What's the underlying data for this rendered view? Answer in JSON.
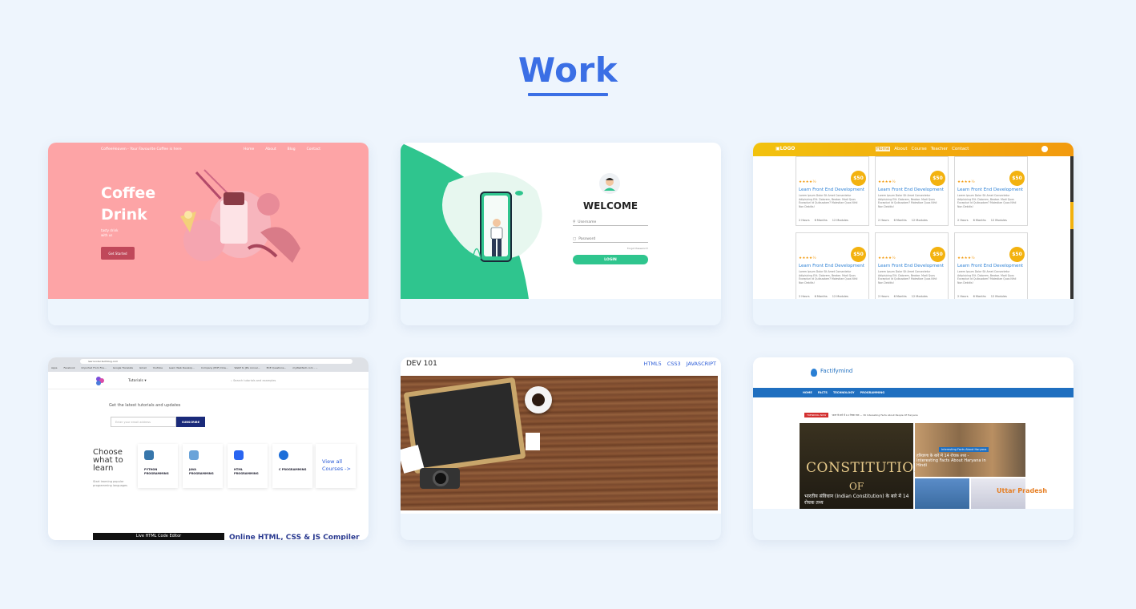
{
  "section": {
    "title": "Work"
  },
  "colors": {
    "accent": "#3b6fe5",
    "background": "#eef5fd"
  },
  "cards": [
    {
      "id": "coffee",
      "nav_brand": "CoffeeHeaven - Your Favourite Coffee is here",
      "nav_links": [
        "Home",
        "About",
        "Blog",
        "Contact"
      ],
      "hero_title": "Coffee Drink",
      "hero_sub": "tasty drink with us",
      "hero_button": "Get Started"
    },
    {
      "id": "login",
      "welcome": "WELCOME",
      "username_placeholder": "Username",
      "password_placeholder": "Password",
      "forgot": "Forgot Password?",
      "login_button": "LOGIN"
    },
    {
      "id": "courses",
      "logo": "LOGO",
      "menu": [
        "Home",
        "About",
        "Course",
        "Teacher",
        "Contact"
      ],
      "price": "$50",
      "stars": "★★★★½",
      "course_title": "Learn Front End Development",
      "course_desc": "Lorem Ipsum Dolor Sit Amet Consectetur Adipisicing Elit. Dolorem, Beatae. Modi Quos Excepturi Id Quibusdam? Molestiae Quos Nihil Non Debitis!",
      "meta": [
        "2 Hours",
        "6 Months",
        "12 Modules"
      ]
    },
    {
      "id": "tutorials",
      "url": "learncoder.techblog.com",
      "bookmarks": [
        "Apps",
        "Facebook",
        "Imported From Fire...",
        "Google Translate",
        "Gmail",
        "YouTube",
        "Learn Web Develop...",
        "Company (PDF) Dow...",
        "WebP to JPG conver...",
        "ECE Questions...",
        "myWebTech.com - ..."
      ],
      "menu": "Tutorials ▾",
      "search": "Search tutorials and examples",
      "subscribe_text": "Get the latest tutorials and updates",
      "email_placeholder": "Enter your email address",
      "subscribe_button": "SUBSCRIBE",
      "choose_title": "Choose what to learn",
      "choose_sub": "Start learning popular programming languages",
      "languages": [
        "PYTHON PROGRAMMING",
        "JAVA PROGRAMMING",
        "HTML PROGRAMMING",
        "C PROGRAMMING"
      ],
      "view_all": "View all Courses ->",
      "editor_label": "Live HTML Code Editor",
      "compiler_title": "Online HTML, CSS & JS Compiler"
    },
    {
      "id": "dev101",
      "brand": "DEV 101",
      "links": [
        "HTML5",
        "CSS3",
        "JAVASCRIPT"
      ]
    },
    {
      "id": "factifymind",
      "logo": "Factifymind",
      "nav": [
        "HOME",
        "FACTS",
        "TECHNOLOGY",
        "PROGRAMMING"
      ],
      "trending_badge": "TRENDING NOW",
      "ticker": "भारत के बारे में 14 रोचक तथ्य — 30 Interesting Facts About People Of Haryana",
      "main_title": "CONSTITUTION",
      "main_of": "OF",
      "main_caption": "भारतीय संविधान (Indian Constitution) के बारे में 14 रोचक तथ्य",
      "side_tag": "Interesting Facts About Haryana",
      "side_caption": "हरियाणा के बारे में 14 रोचक तथ्य - Interesting Facts About Haryana in Hindi",
      "side_city": "Uttar Pradesh"
    }
  ]
}
